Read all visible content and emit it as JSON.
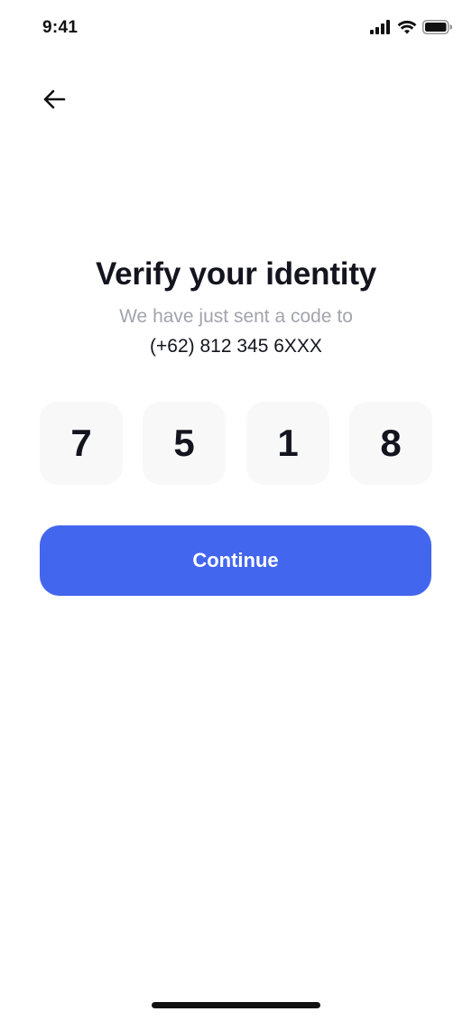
{
  "status_bar": {
    "time": "9:41"
  },
  "header": {
    "back_icon": "arrow-left-icon"
  },
  "content": {
    "title": "Verify your identity",
    "subtitle": "We have just sent a code to",
    "phone": "(+62) 812 345 6XXX"
  },
  "code": {
    "digits": [
      "7",
      "5",
      "1",
      "8"
    ]
  },
  "actions": {
    "continue_label": "Continue"
  },
  "colors": {
    "accent": "#4366EE",
    "title_text": "#14141F",
    "muted_text": "#A3A3AD",
    "code_box_bg": "#F8F8F9"
  }
}
